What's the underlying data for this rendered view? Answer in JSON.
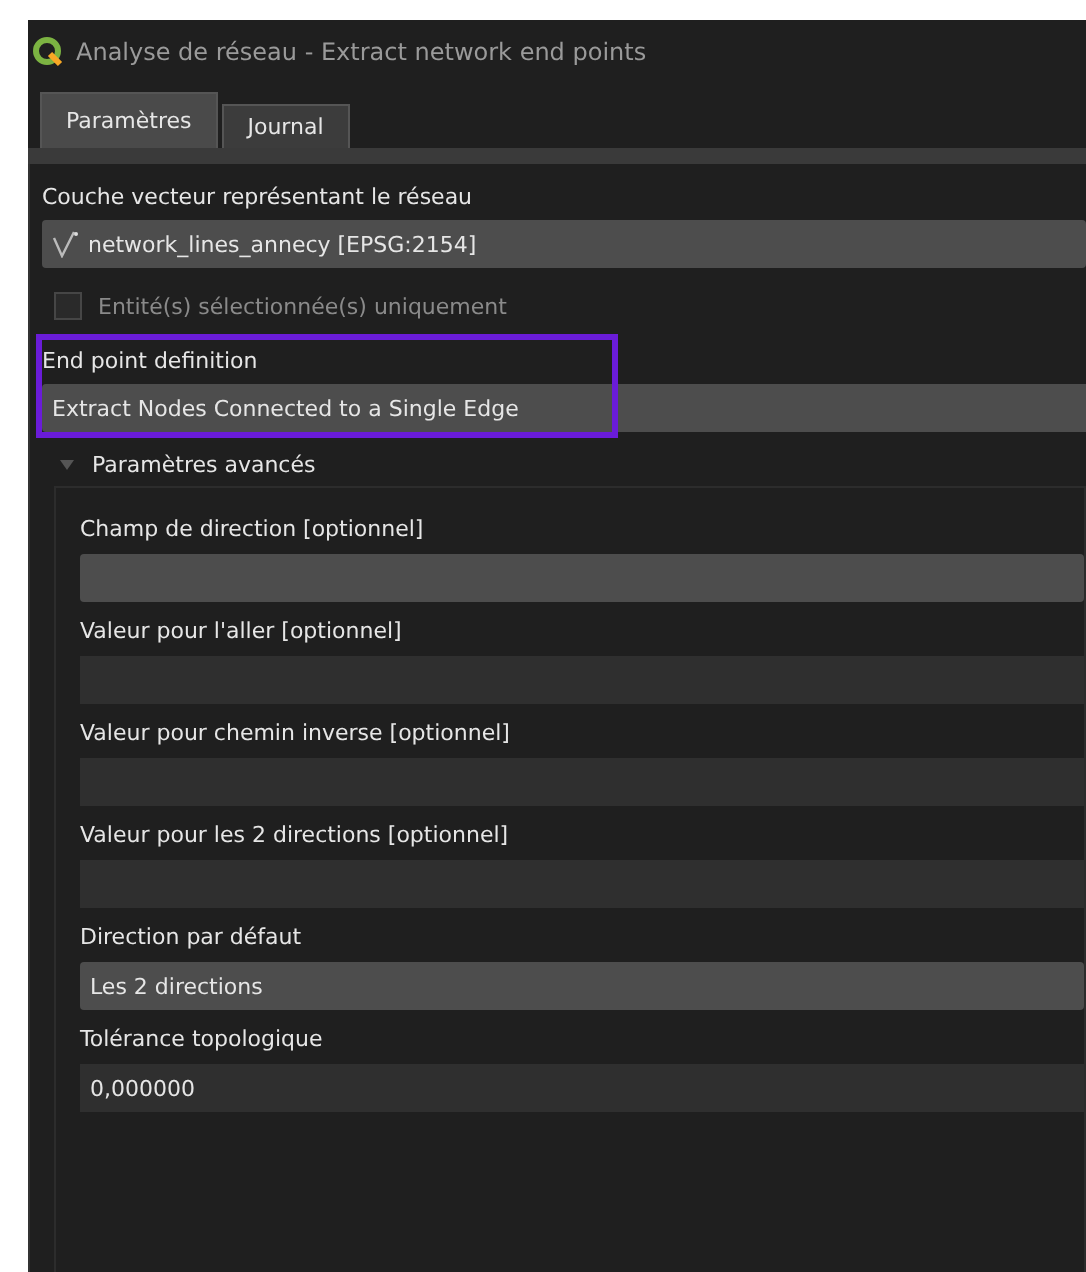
{
  "window": {
    "title": "Analyse de réseau - Extract network end points"
  },
  "tabs": [
    {
      "label": "Paramètres",
      "selected": true
    },
    {
      "label": "Journal",
      "selected": false
    }
  ],
  "parameters": [
    {
      "label": "Couche vecteur représentant le réseau",
      "kind": "layer",
      "value": "network_lines_annecy [EPSG:2154]"
    },
    {
      "kind": "checkbox",
      "label": "Entité(s) sélectionnée(s) uniquement",
      "checked": false,
      "disabled": true
    },
    {
      "label": "End point definition",
      "kind": "combo",
      "value": "Extract Nodes Connected to a Single Edge",
      "highlighted": true
    }
  ],
  "advanced": {
    "title": "Paramètres avancés",
    "expanded": true,
    "parameters": [
      {
        "label": "Champ de direction [optionnel]",
        "kind": "combo"
      },
      {
        "label": "Valeur pour l'aller [optionnel]",
        "kind": "line"
      },
      {
        "label": "Valeur pour chemin inverse [optionnel]",
        "kind": "line"
      },
      {
        "label": "Valeur pour les 2 directions [optionnel]",
        "kind": "line"
      },
      {
        "label": "Direction par défaut",
        "kind": "combo",
        "value": "Les 2 directions"
      },
      {
        "label": "Tolérance topologique",
        "kind": "line",
        "value": "0,000000"
      }
    ]
  }
}
